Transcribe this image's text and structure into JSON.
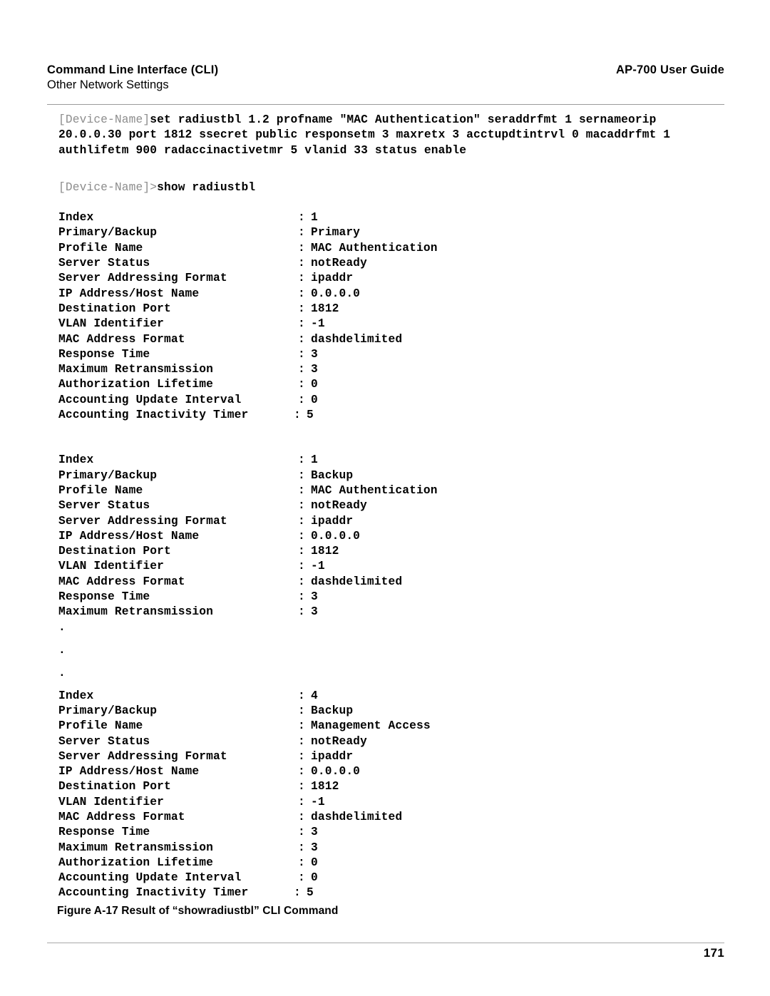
{
  "header": {
    "title": "Command Line Interface (CLI)",
    "subtitle": "Other Network Settings",
    "guide": "AP-700 User Guide"
  },
  "cli": {
    "set_command": {
      "prompt": "[Device-Name]",
      "lines": [
        "set radiustbl 1.2 profname \"MAC Authentication\" seraddrfmt 1 sernameorip",
        "20.0.0.30 port 1812 ssecret public responsetm 3 maxretx 3 acctupdtintrvl 0 macaddrfmt 1",
        "authlifetm 900 radaccinactivetmr 5 vlanid 33 status enable"
      ]
    },
    "show_command": {
      "prompt": "[Device-Name]>",
      "text": "show radiustbl"
    },
    "ellipsis": [
      ".",
      ".",
      "."
    ],
    "blocks": [
      {
        "rows": [
          {
            "key": "Index",
            "value": "1"
          },
          {
            "key": "Primary/Backup",
            "value": "Primary"
          },
          {
            "key": "Profile Name",
            "value": "MAC Authentication"
          },
          {
            "key": "Server Status",
            "value": "notReady"
          },
          {
            "key": "Server Addressing Format",
            "value": "ipaddr"
          },
          {
            "key": "IP Address/Host Name",
            "value": "0.0.0.0"
          },
          {
            "key": "Destination Port",
            "value": "1812"
          },
          {
            "key": "VLAN Identifier",
            "value": "-1"
          },
          {
            "key": "MAC Address Format",
            "value": "dashdelimited"
          },
          {
            "key": "Response Time",
            "value": "3"
          },
          {
            "key": "Maximum Retransmission",
            "value": "3"
          },
          {
            "key": "Authorization Lifetime",
            "value": "0"
          },
          {
            "key": "Accounting Update Interval",
            "value": "0"
          },
          {
            "key": "Accounting Inactivity Timer",
            "value": "5",
            "long": true
          }
        ]
      },
      {
        "rows": [
          {
            "key": "Index",
            "value": "1"
          },
          {
            "key": "Primary/Backup",
            "value": "Backup"
          },
          {
            "key": "Profile Name",
            "value": "MAC Authentication"
          },
          {
            "key": "Server Status",
            "value": "notReady"
          },
          {
            "key": "Server Addressing Format",
            "value": "ipaddr"
          },
          {
            "key": "IP Address/Host Name",
            "value": "0.0.0.0"
          },
          {
            "key": "Destination Port",
            "value": "1812"
          },
          {
            "key": "VLAN Identifier",
            "value": "-1"
          },
          {
            "key": "MAC Address Format",
            "value": "dashdelimited"
          },
          {
            "key": "Response Time",
            "value": "3"
          },
          {
            "key": "Maximum Retransmission",
            "value": "3"
          }
        ]
      },
      {
        "rows": [
          {
            "key": "Index",
            "value": "4"
          },
          {
            "key": "Primary/Backup",
            "value": "Backup"
          },
          {
            "key": "Profile Name",
            "value": "Management Access"
          },
          {
            "key": "Server Status",
            "value": "notReady"
          },
          {
            "key": "Server Addressing Format",
            "value": "ipaddr"
          },
          {
            "key": "IP Address/Host Name",
            "value": "0.0.0.0"
          },
          {
            "key": "Destination Port",
            "value": "1812"
          },
          {
            "key": "VLAN Identifier",
            "value": "-1"
          },
          {
            "key": "MAC Address Format",
            "value": "dashdelimited"
          },
          {
            "key": "Response Time",
            "value": "3"
          },
          {
            "key": "Maximum Retransmission",
            "value": "3"
          },
          {
            "key": "Authorization Lifetime",
            "value": "0"
          },
          {
            "key": "Accounting Update Interval",
            "value": "0"
          },
          {
            "key": "Accounting Inactivity Timer",
            "value": "5",
            "long": true
          }
        ]
      }
    ]
  },
  "figure": {
    "caption": "Figure A-17 Result of “showradiustbl” CLI Command"
  },
  "footer": {
    "page_number": "171"
  },
  "colors": {
    "text": "#000000",
    "prompt_dim": "#8d8d8d",
    "rule": "#9a9a9a"
  }
}
